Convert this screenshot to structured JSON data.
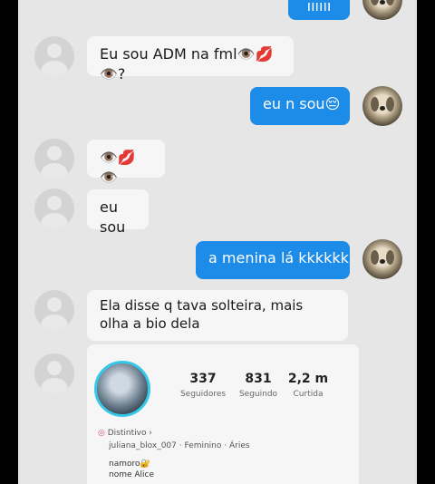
{
  "messages": [
    {
      "dir": "out",
      "text": "ıııııı"
    },
    {
      "dir": "in",
      "text": "Eu sou ADM na fml👁️💋👁️?"
    },
    {
      "dir": "out",
      "text": "eu n sou😔"
    },
    {
      "dir": "in",
      "text": "👁️💋👁️"
    },
    {
      "dir": "in",
      "text": "eu sou"
    },
    {
      "dir": "out",
      "text": "a menina lá kkkkkk"
    },
    {
      "dir": "in",
      "text": "Ela disse q tava solteira, mais olha a bio dela"
    }
  ],
  "profile_card": {
    "stats": [
      {
        "value": "337",
        "label": "Seguidores"
      },
      {
        "value": "831",
        "label": "Seguindo"
      },
      {
        "value": "2,2 m",
        "label": "Curtida"
      }
    ],
    "badge": "Distintivo ›",
    "details": "juliana_blox_007 · Feminino · Áries",
    "bio_line1": "namoro🔐",
    "bio_line2": "nome Alice"
  },
  "colors": {
    "bubble_out": "#1d8be8",
    "bubble_in": "#f6f6f6",
    "background": "#e6e6e6",
    "story_ring": "#35c8e8"
  }
}
